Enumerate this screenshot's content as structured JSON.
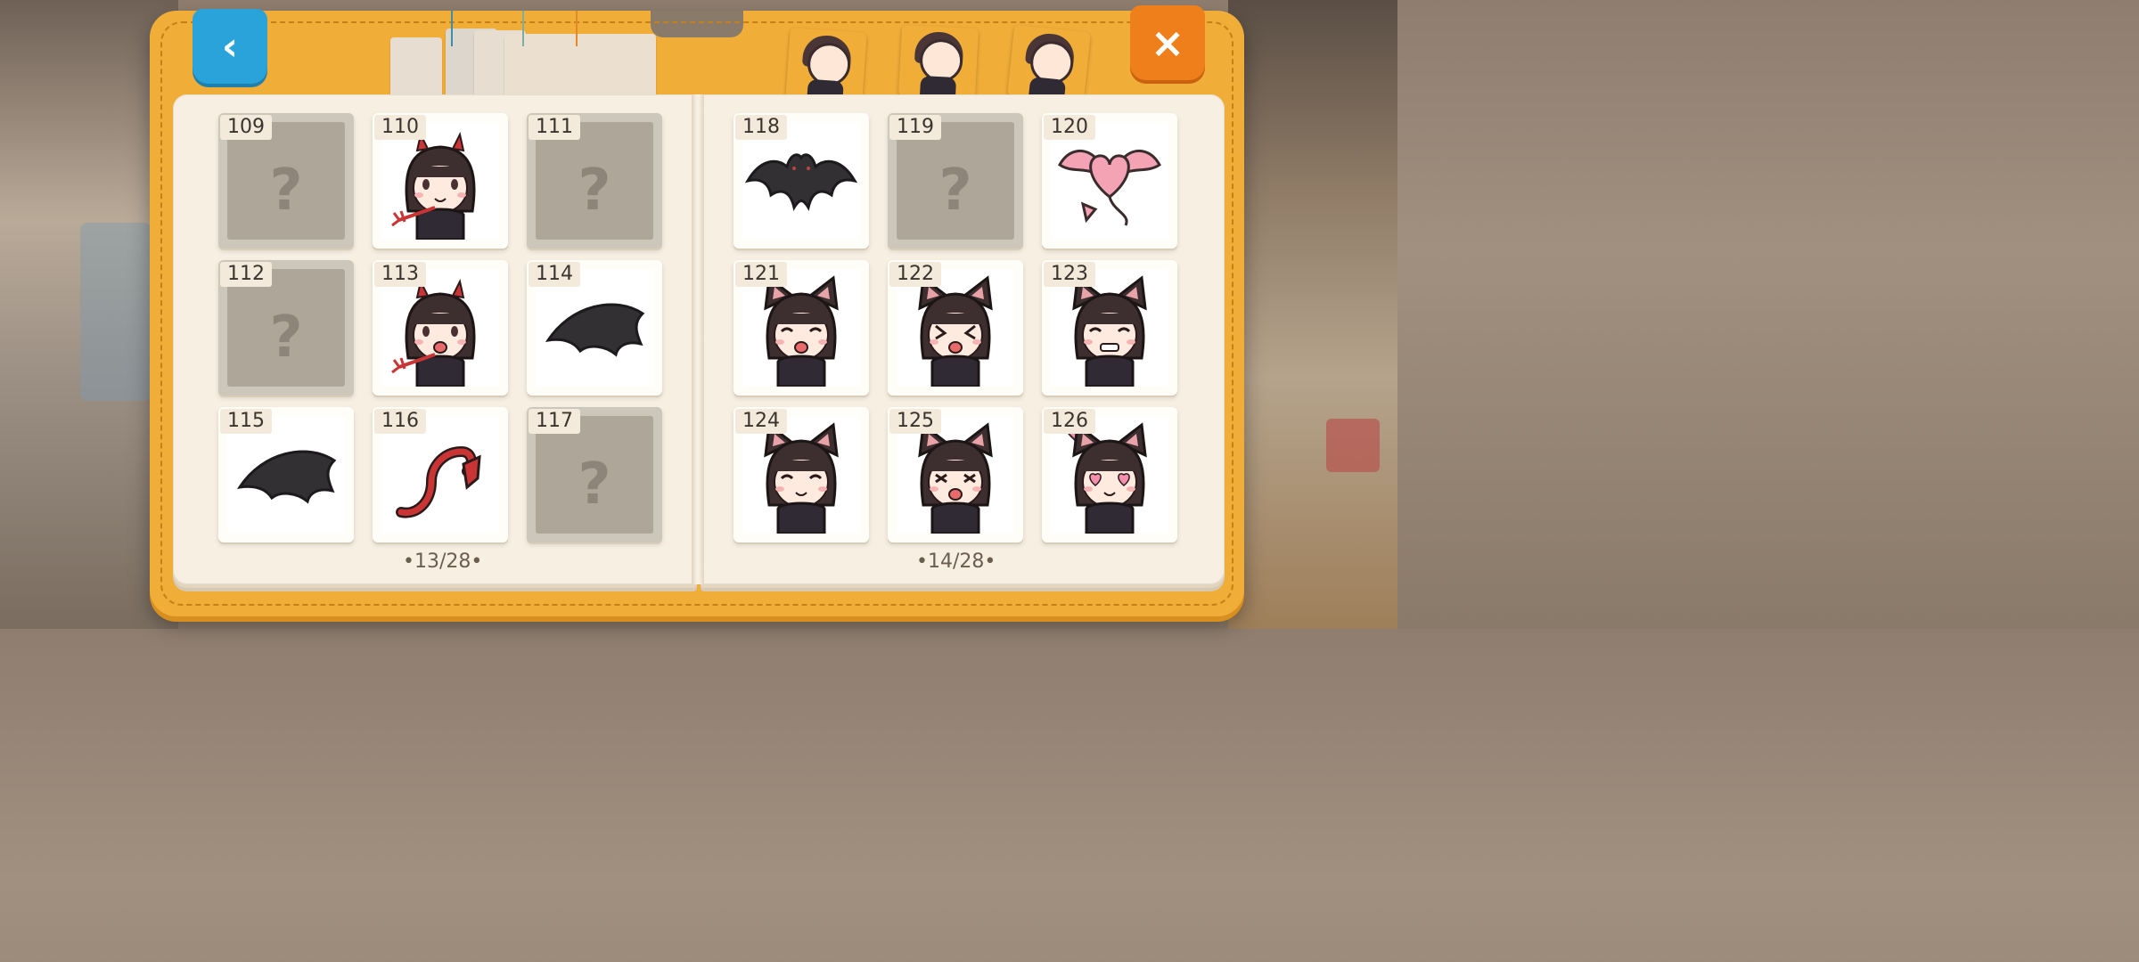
{
  "header": {
    "back_icon": "‹",
    "close_icon": "×",
    "sticker_tabs": [
      {
        "name": "character-sticker-1",
        "color": "#e85a5a"
      },
      {
        "name": "character-sticker-2",
        "color": "#d9534f"
      },
      {
        "name": "character-sticker-3",
        "color": "#ff6b6b"
      }
    ]
  },
  "left_page": {
    "page_indicator": "•13/28•",
    "items": [
      {
        "number": "109",
        "locked": true,
        "icon": "question-mark"
      },
      {
        "number": "110",
        "locked": false,
        "icon": "devil-girl-crawling"
      },
      {
        "number": "111",
        "locked": true,
        "icon": "question-mark"
      },
      {
        "number": "112",
        "locked": true,
        "icon": "question-mark"
      },
      {
        "number": "113",
        "locked": false,
        "icon": "devil-girl-trident"
      },
      {
        "number": "114",
        "locked": false,
        "icon": "bat-wing"
      },
      {
        "number": "115",
        "locked": false,
        "icon": "bat-wing"
      },
      {
        "number": "116",
        "locked": false,
        "icon": "devil-tail"
      },
      {
        "number": "117",
        "locked": true,
        "icon": "question-mark"
      }
    ]
  },
  "right_page": {
    "page_indicator": "•14/28•",
    "items": [
      {
        "number": "118",
        "locked": false,
        "icon": "bat"
      },
      {
        "number": "119",
        "locked": true,
        "icon": "question-mark"
      },
      {
        "number": "120",
        "locked": false,
        "icon": "pink-heart-wings"
      },
      {
        "number": "121",
        "locked": false,
        "icon": "cat-girl-surprised"
      },
      {
        "number": "122",
        "locked": false,
        "icon": "cat-girl-squint"
      },
      {
        "number": "123",
        "locked": false,
        "icon": "cat-girl-grin"
      },
      {
        "number": "124",
        "locked": false,
        "icon": "cat-girl-smile"
      },
      {
        "number": "125",
        "locked": false,
        "icon": "cat-girl-excited"
      },
      {
        "number": "126",
        "locked": false,
        "icon": "cat-girl-heart-eyes"
      }
    ]
  },
  "locked_symbol": "?",
  "colors": {
    "binder": "#f0ad38",
    "back_button": "#2aa3da",
    "close_button": "#ef7f1a",
    "page": "#f7efe2"
  }
}
